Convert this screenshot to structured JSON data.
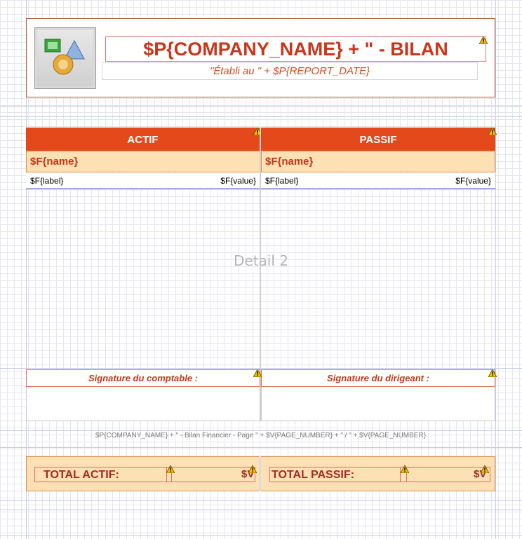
{
  "title": {
    "main": "$P{COMPANY_NAME} + \" - BILAN",
    "subtitle": "\"Établi au \" + $P{REPORT_DATE}"
  },
  "columns": [
    {
      "header": "ACTIF",
      "group": "$F{name}",
      "detail_label": "$F{label}",
      "detail_value": "$F{value}",
      "signature": "Signature du comptable :",
      "total_label": "TOTAL ACTIF:",
      "total_value": "$V"
    },
    {
      "header": "PASSIF",
      "group": "$F{name}",
      "detail_label": "$F{label}",
      "detail_value": "$F{value}",
      "signature": "Signature du dirigeant :",
      "total_label": "TOTAL PASSIF:",
      "total_value": "$V"
    }
  ],
  "band_label": "Detail 2",
  "footer": "$P{COMPANY_NAME} + \" - Bilan Financier - Page \" + $V{PAGE_NUMBER} + \" / \" + $V{PAGE_NUMBER}",
  "icons": {
    "logo": "image-placeholder-icon",
    "warning": "warning-icon"
  },
  "colors": {
    "header_bg": "#e4491c",
    "group_bg": "#fde0b3",
    "title_text": "#c9361b",
    "total_text": "#a02c24"
  }
}
